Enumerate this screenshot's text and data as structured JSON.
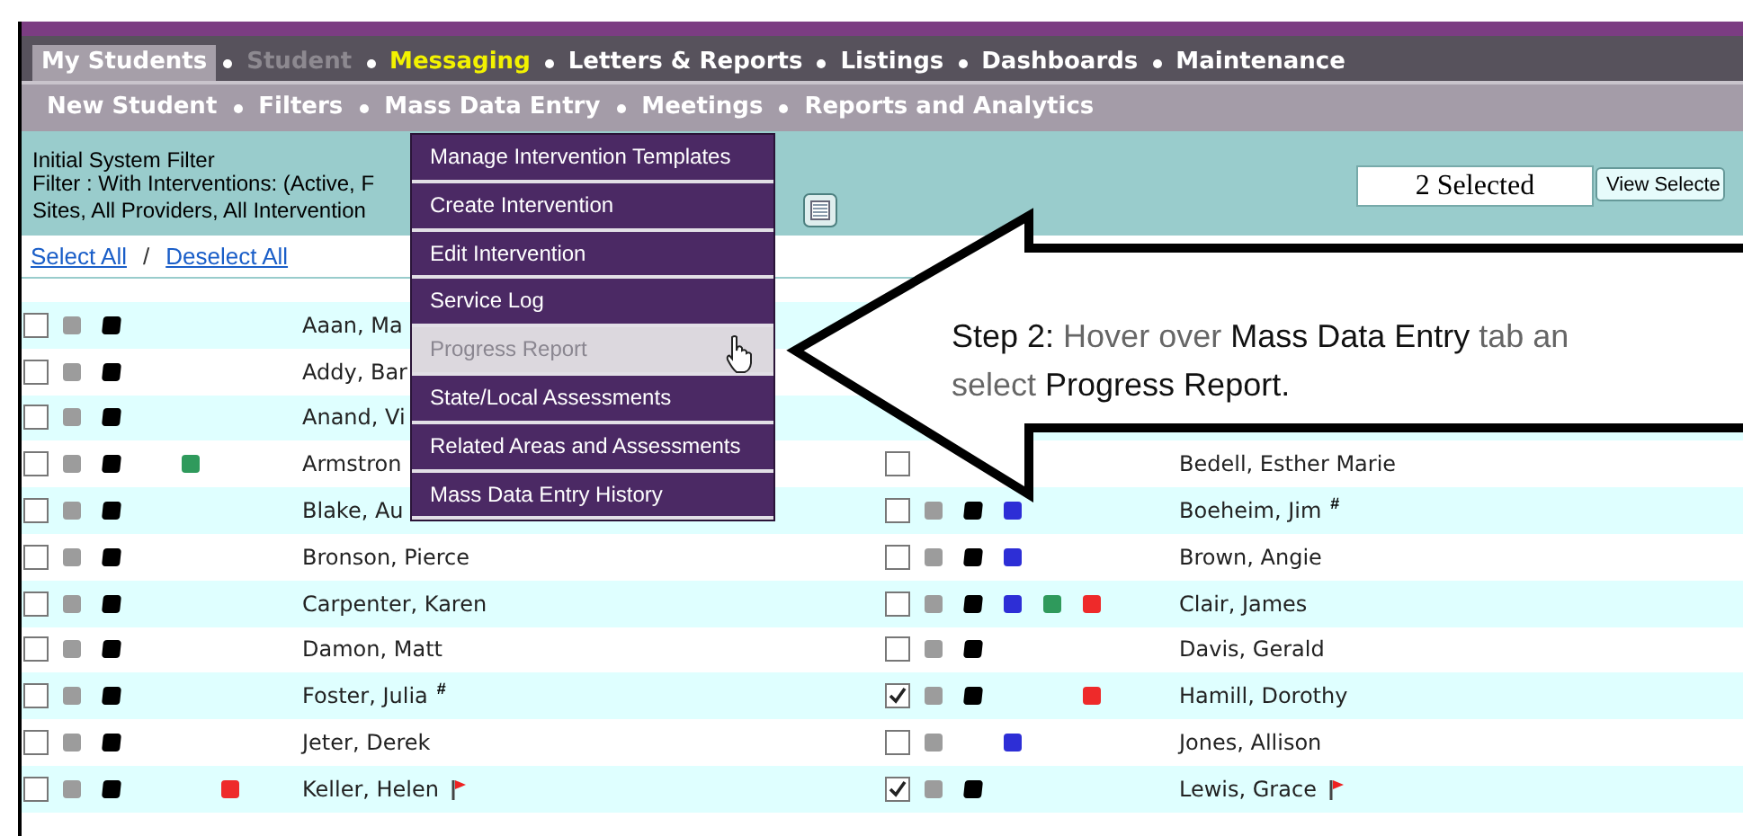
{
  "main_nav": [
    {
      "label": "My Students",
      "kind": "normal",
      "selected": true
    },
    {
      "label": "Student",
      "kind": "disabled",
      "selected": false
    },
    {
      "label": "Messaging",
      "kind": "highlight",
      "selected": false
    },
    {
      "label": "Letters & Reports",
      "kind": "normal",
      "selected": false
    },
    {
      "label": "Listings",
      "kind": "normal",
      "selected": false
    },
    {
      "label": "Dashboards",
      "kind": "normal",
      "selected": false
    },
    {
      "label": "Maintenance",
      "kind": "normal",
      "selected": false
    }
  ],
  "sub_nav": [
    "New Student",
    "Filters",
    "Mass Data Entry",
    "Meetings",
    "Reports and Analytics"
  ],
  "filter": {
    "title": "Initial System Filter",
    "lines": [
      "Filter : With Interventions: (Active, F",
      "Sites, All Providers, All Intervention"
    ],
    "selected_count": "2 Selected",
    "view_button": "View Selecte"
  },
  "select_all": "Select All",
  "separator": "/",
  "deselect_all": "Deselect All",
  "dropdown": [
    {
      "label": "Manage Intervention Templates",
      "selected": false
    },
    {
      "label": "Create Intervention",
      "selected": false
    },
    {
      "label": "Edit Intervention",
      "selected": false
    },
    {
      "label": "Service Log",
      "selected": false
    },
    {
      "label": "Progress Report",
      "selected": true
    },
    {
      "label": "State/Local Assessments",
      "selected": false
    },
    {
      "label": "Related Areas and Assessments",
      "selected": false
    },
    {
      "label": "Mass Data Entry History",
      "selected": false
    }
  ],
  "callout": [
    [
      {
        "text": "Step 2:",
        "emphasis": true
      },
      {
        "text": " Hover over ",
        "emphasis": false
      },
      {
        "text": "Mass Data Entry",
        "emphasis": true
      },
      {
        "text": " tab an",
        "emphasis": false
      }
    ],
    [
      {
        "text": "select ",
        "emphasis": false
      },
      {
        "text": "Progress Report.",
        "emphasis": true
      }
    ]
  ],
  "rows": [
    {
      "left": {
        "name": "Aaan, Ma",
        "checked": false,
        "markers": [
          {
            "kind": "gray"
          },
          {
            "kind": "black"
          }
        ]
      }
    },
    {
      "left": {
        "name": "Addy, Bar",
        "checked": false,
        "markers": [
          {
            "kind": "gray"
          },
          {
            "kind": "black"
          }
        ]
      }
    },
    {
      "left": {
        "name": "Anand, Vi",
        "checked": false,
        "markers": [
          {
            "kind": "gray"
          },
          {
            "kind": "black"
          }
        ]
      }
    },
    {
      "left": {
        "name": "Armstron",
        "checked": false,
        "markers": [
          {
            "kind": "gray"
          },
          {
            "kind": "black"
          },
          {
            "kind": "green"
          }
        ]
      },
      "right": {
        "name": "Bedell, Esther Marie",
        "checked": false
      }
    },
    {
      "left": {
        "name": "Blake, Au",
        "checked": false,
        "markers": [
          {
            "kind": "gray"
          },
          {
            "kind": "black"
          }
        ]
      },
      "right": {
        "name": "Boeheim, Jim",
        "note": "#",
        "checked": false,
        "markers": [
          {
            "kind": "gray"
          },
          {
            "kind": "black"
          },
          {
            "kind": "blue"
          }
        ]
      }
    },
    {
      "left": {
        "name": "Bronson, Pierce",
        "checked": false,
        "markers": [
          {
            "kind": "gray"
          },
          {
            "kind": "black"
          }
        ]
      },
      "right": {
        "name": "Brown, Angie",
        "checked": false,
        "markers": [
          {
            "kind": "gray"
          },
          {
            "kind": "black"
          },
          {
            "kind": "blue"
          }
        ]
      }
    },
    {
      "left": {
        "name": "Carpenter, Karen",
        "checked": false,
        "markers": [
          {
            "kind": "gray"
          },
          {
            "kind": "black"
          }
        ]
      },
      "right": {
        "name": "Clair, James",
        "checked": false,
        "markers": [
          {
            "kind": "gray"
          },
          {
            "kind": "black"
          },
          {
            "kind": "blue"
          },
          {
            "kind": "green"
          },
          {
            "kind": "red"
          }
        ]
      }
    },
    {
      "left": {
        "name": "Damon, Matt",
        "checked": false,
        "markers": [
          {
            "kind": "gray"
          },
          {
            "kind": "black"
          }
        ]
      },
      "right": {
        "name": "Davis, Gerald",
        "checked": false,
        "markers": [
          {
            "kind": "gray"
          },
          {
            "kind": "black"
          }
        ]
      }
    },
    {
      "left": {
        "name": "Foster, Julia",
        "note": "#",
        "checked": false,
        "markers": [
          {
            "kind": "gray"
          },
          {
            "kind": "black"
          }
        ]
      },
      "right": {
        "name": "Hamill, Dorothy",
        "checked": true,
        "markers": [
          {
            "kind": "gray"
          },
          {
            "kind": "black"
          },
          {
            "kind": "red"
          }
        ]
      }
    },
    {
      "left": {
        "name": "Jeter, Derek",
        "checked": false,
        "markers": [
          {
            "kind": "gray"
          },
          {
            "kind": "black"
          }
        ]
      },
      "right": {
        "name": "Jones, Allison",
        "checked": false,
        "markers": [
          {
            "kind": "gray"
          },
          {
            "kind": "blue"
          }
        ]
      }
    },
    {
      "left": {
        "name": "Keller, Helen",
        "flagged": true,
        "checked": false,
        "markers": [
          {
            "kind": "gray"
          },
          {
            "kind": "black"
          },
          {
            "kind": "red"
          }
        ]
      },
      "right": {
        "name": "Lewis, Grace",
        "flagged": true,
        "checked": true,
        "markers": [
          {
            "kind": "gray"
          },
          {
            "kind": "black"
          }
        ]
      }
    }
  ]
}
